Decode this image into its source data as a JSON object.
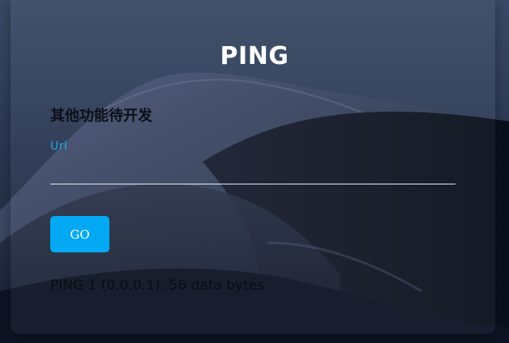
{
  "app": {
    "title": "PING",
    "subtitle": "其他功能待开发"
  },
  "form": {
    "url_label": "Url",
    "url_value": "",
    "go_label": "GO"
  },
  "output": {
    "result_line": "PING 1 (0.0.0.1): 56 data bytes"
  },
  "colors": {
    "accent": "#03a9f4",
    "label_accent": "#1ea7e6",
    "title_text": "#ffffff",
    "body_text": "#0a0d14",
    "underline": "#e8ecf2"
  },
  "background": {
    "description_icon": "desert-dunes-wallpaper"
  }
}
